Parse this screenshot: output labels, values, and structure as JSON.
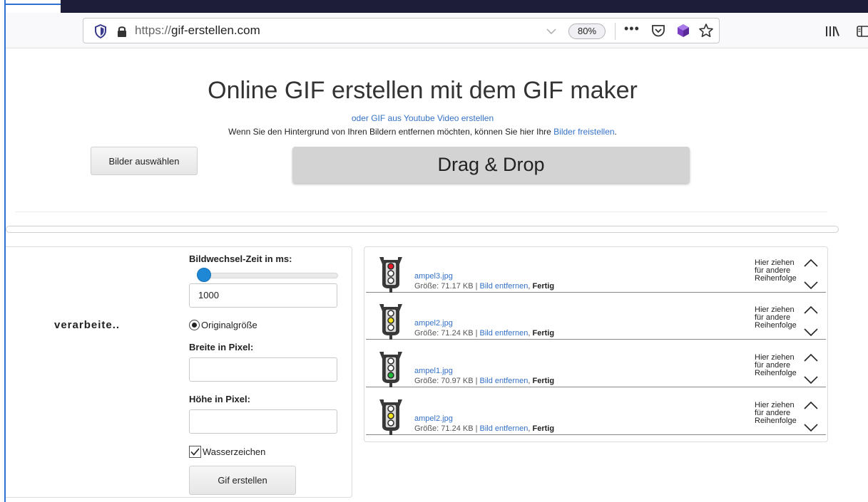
{
  "browser": {
    "url_scheme": "https://",
    "url_host": "gif-erstellen.com",
    "zoom": "80%",
    "more_menu": "•••"
  },
  "page": {
    "title": "Online GIF erstellen mit dem GIF maker",
    "youtube_link": "oder GIF aus Youtube Video erstellen",
    "bg_text": "Wenn Sie den Hintergrund von Ihren Bildern entfernen möchten, können Sie hier Ihre ",
    "bg_link": "Bilder freistellen",
    "bg_period": ".",
    "select_button": "Bilder auswählen",
    "dropzone": "Drag & Drop",
    "processing": "verarbeite.."
  },
  "settings": {
    "interval_label": "Bildwechsel-Zeit in ms:",
    "interval_value": "1000",
    "interval_slider_fraction": 0.0,
    "original_size_label": "Originalgröße",
    "original_size_selected": true,
    "width_label": "Breite in Pixel:",
    "width_value": "",
    "height_label": "Höhe in Pixel:",
    "height_value": "",
    "watermark_label": "Wasserzeichen",
    "watermark_checked": true,
    "create_button": "Gif erstellen"
  },
  "images": [
    {
      "name": "ampel3.jpg",
      "size_prefix": "Größe: 71.17 KB | ",
      "remove": "Bild entfernen",
      "sep": ", ",
      "status": "Fertig",
      "light": "red"
    },
    {
      "name": "ampel2.jpg",
      "size_prefix": "Größe: 71.24 KB | ",
      "remove": "Bild entfernen",
      "sep": ", ",
      "status": "Fertig",
      "light": "yellow"
    },
    {
      "name": "ampel1.jpg",
      "size_prefix": "Größe: 70.97 KB | ",
      "remove": "Bild entfernen",
      "sep": ", ",
      "status": "Fertig",
      "light": "green"
    },
    {
      "name": "ampel2.jpg",
      "size_prefix": "Größe: 71.24 KB | ",
      "remove": "Bild entfernen",
      "sep": ", ",
      "status": "Fertig",
      "light": "yellow"
    }
  ],
  "drag_hint": {
    "line1": "Hier ziehen",
    "line2": "für andere",
    "line3": "Reihenfolge"
  },
  "colors": {
    "link": "#3471c6",
    "light_red": "#e8182b",
    "light_yellow": "#f2e21b",
    "light_green": "#1fb83a",
    "light_off": "#ffffff",
    "slider_thumb": "#1e88d6"
  }
}
